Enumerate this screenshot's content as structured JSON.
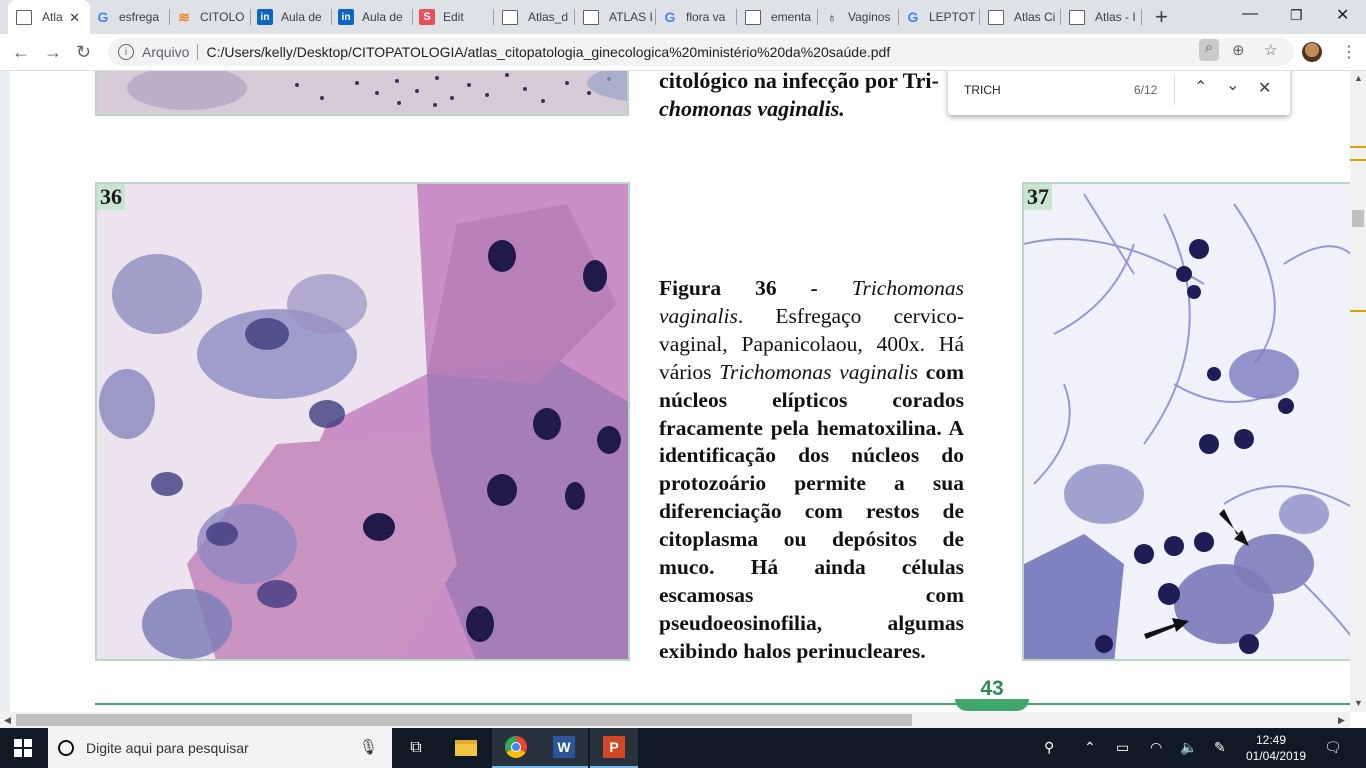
{
  "browser": {
    "tabs": [
      {
        "label": "Atla",
        "icon": "pdf-doc-icon",
        "active": true
      },
      {
        "label": "esfrega",
        "icon": "google-icon"
      },
      {
        "label": "CITOLO",
        "icon": "stackoverflow-icon"
      },
      {
        "label": "Aula de",
        "icon": "linkedin-icon"
      },
      {
        "label": "Aula de",
        "icon": "linkedin-icon"
      },
      {
        "label": "Edit",
        "icon": "slides-icon"
      },
      {
        "label": "Atlas_d",
        "icon": "pdf-doc-icon"
      },
      {
        "label": "ATLAS I",
        "icon": "pdf-doc-icon"
      },
      {
        "label": "flora va",
        "icon": "google-icon"
      },
      {
        "label": "ementa",
        "icon": "pdf-doc-icon"
      },
      {
        "label": "Vaginos",
        "icon": "vaginose-icon"
      },
      {
        "label": "LEPTOT",
        "icon": "google-icon"
      },
      {
        "label": "Atlas Ci",
        "icon": "pdf-doc-icon"
      },
      {
        "label": "Atlas - I",
        "icon": "pdf-doc-icon"
      }
    ],
    "address": {
      "scheme_label": "Arquivo",
      "url": "C:/Users/kelly/Desktop/CITOPATOLOGIA/atlas_citopatologia_ginecologica%20ministério%20da%20saúde.pdf"
    },
    "find": {
      "query": "TRICH",
      "count": "6/12"
    }
  },
  "pdf": {
    "top_caption_line1": "citológico na infecção por Tri-",
    "top_caption_line2": "chomonas vaginalis.",
    "figure36_label": "36",
    "figure37_label": "37",
    "caption36": {
      "lead": "Figura 36 - ",
      "species": "Trichomonas vaginalis",
      "after_species": ". Esfregaço cervico-vaginal, Papanicolaou, 400x. Há vários ",
      "species2": "Trichomonas vaginalis",
      "body_bold": " com núcleos elípticos corados fracamente pela hematoxilina. A identificação dos núcleos do protozoário permite a sua diferenciação com restos de citoplasma ou depósitos de muco. Há ainda células escamosas com pseudoeosinofilia, algumas exibindo halos perinucleares."
    },
    "page_number": "43"
  },
  "taskbar": {
    "search_placeholder": "Digite aqui para pesquisar",
    "time": "12:49",
    "date": "01/04/2019"
  }
}
